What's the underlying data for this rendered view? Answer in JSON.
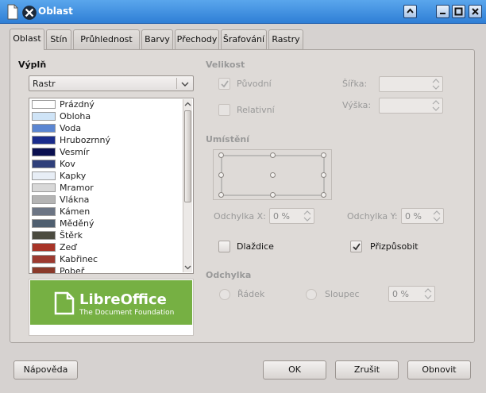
{
  "window": {
    "title": "Oblast"
  },
  "tabs": [
    "Oblast",
    "Stín",
    "Průhlednost",
    "Barvy",
    "Přechody",
    "Šrafování",
    "Rastry"
  ],
  "fill": {
    "label": "Výplň",
    "type": "Rastr",
    "items": [
      {
        "name": "Prázdný",
        "color": "#ffffff"
      },
      {
        "name": "Obloha",
        "color": "#cfe4f7"
      },
      {
        "name": "Voda",
        "color": "#5b86d2"
      },
      {
        "name": "Hrubozrnný",
        "color": "#1a2c8c"
      },
      {
        "name": "Vesmír",
        "color": "#0a1050"
      },
      {
        "name": "Kov",
        "color": "#2f3f7a"
      },
      {
        "name": "Kapky",
        "color": "#e8eef6"
      },
      {
        "name": "Mramor",
        "color": "#d8d8d8"
      },
      {
        "name": "Vlákna",
        "color": "#b4b4b4"
      },
      {
        "name": "Kámen",
        "color": "#6c7584"
      },
      {
        "name": "Měděný",
        "color": "#4f5f70"
      },
      {
        "name": "Štěrk",
        "color": "#4b4b40"
      },
      {
        "name": "Zeď",
        "color": "#a83428"
      },
      {
        "name": "Kabřinec",
        "color": "#9c3a30"
      },
      {
        "name": "Pobeř",
        "color": "#8a3a2a"
      }
    ],
    "preview": {
      "brand": "LibreOffice",
      "tagline": "The Document Foundation"
    }
  },
  "size": {
    "heading": "Velikost",
    "original_label": "Původní",
    "relative_label": "Relativní",
    "width_label": "Šířka:",
    "height_label": "Výška:"
  },
  "position": {
    "heading": "Umístění",
    "offset_x_label": "Odchylka X:",
    "offset_x_value": "0 %",
    "offset_y_label": "Odchylka Y:",
    "offset_y_value": "0 %",
    "tile_label": "Dlaždice",
    "autofit_label": "Přizpůsobit"
  },
  "offset": {
    "heading": "Odchylka",
    "row_label": "Řádek",
    "column_label": "Sloupec",
    "value": "0 %"
  },
  "buttons": {
    "help": "Nápověda",
    "ok": "OK",
    "cancel": "Zrušit",
    "reset": "Obnovit"
  },
  "colors": {
    "titlebar": "#3a8ae0",
    "libreoffice_green": "#76b043"
  }
}
